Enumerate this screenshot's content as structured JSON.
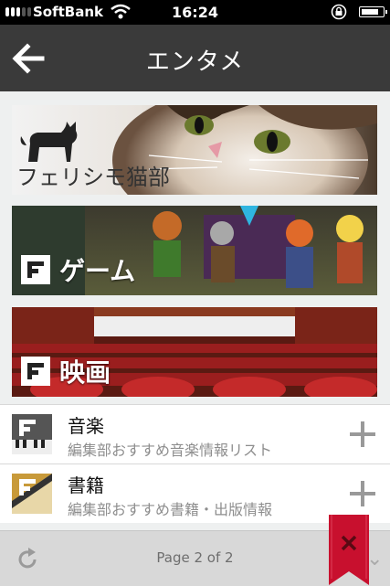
{
  "status_bar": {
    "carrier": "SoftBank",
    "time": "16:24"
  },
  "nav": {
    "title": "エンタメ",
    "back_icon": "back-arrow-icon"
  },
  "banners": {
    "cat": {
      "label": "フェリシモ猫部"
    },
    "game": {
      "label": "ゲーム"
    },
    "movie": {
      "label": "映画"
    }
  },
  "list": [
    {
      "name": "音楽",
      "description": "編集部おすすめ音楽情報リスト",
      "icon": "music-thumbnail"
    },
    {
      "name": "書籍",
      "description": "編集部おすすめ書籍・出版情報",
      "icon": "books-thumbnail"
    }
  ],
  "footer": {
    "page_indicator": "Page 2 of 2",
    "refresh_icon": "refresh-icon",
    "close_icon": "close-icon"
  },
  "colors": {
    "nav_bg": "#3a3a3a",
    "ribbon": "#c8102e",
    "footer_bg": "#d8d8d8"
  }
}
